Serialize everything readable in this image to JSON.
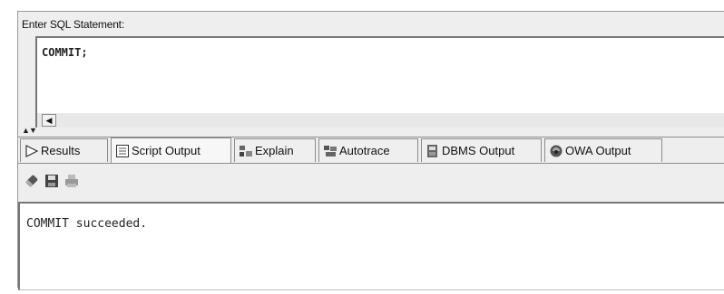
{
  "sql_panel": {
    "prompt_label": "Enter SQL Statement:",
    "statement": "COMMIT;"
  },
  "tabs": [
    {
      "label": "Results",
      "icon": "play-icon"
    },
    {
      "label": "Script Output",
      "icon": "script-icon"
    },
    {
      "label": "Explain",
      "icon": "explain-icon"
    },
    {
      "label": "Autotrace",
      "icon": "autotrace-icon"
    },
    {
      "label": "DBMS Output",
      "icon": "dbms-output-icon"
    },
    {
      "label": "OWA Output",
      "icon": "owa-output-icon"
    }
  ],
  "active_tab": "Script Output",
  "toolbar": {
    "tools": [
      "eraser-icon",
      "save-icon",
      "print-icon"
    ]
  },
  "output": {
    "text": "COMMIT succeeded."
  }
}
